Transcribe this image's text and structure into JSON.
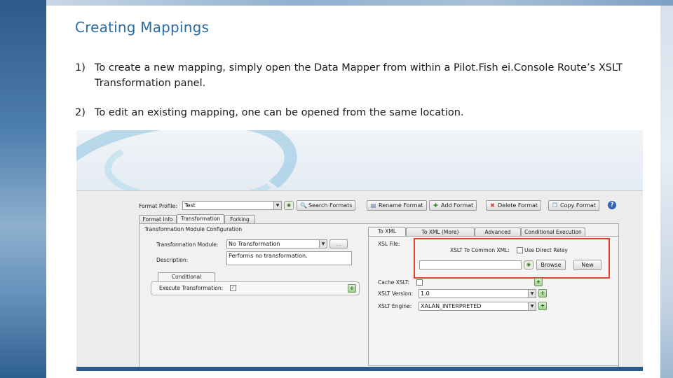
{
  "slide": {
    "title": "Creating Mappings",
    "steps": [
      {
        "num": "1)",
        "line1": "To create a new mapping, simply open the Data Mapper from within a Pilot.Fish ei.Console Route’s XSLT",
        "line2": "Transformation panel."
      },
      {
        "num": "2)",
        "line1": "To edit an existing mapping, one can be opened from the same location."
      }
    ]
  },
  "app": {
    "format_profile_label": "Format Profile:",
    "format_profile_value": "Test",
    "toolbar": {
      "search": "Search Formats",
      "rename": "Rename Format",
      "add": "Add Format",
      "delete": "Delete Format",
      "copy": "Copy Format",
      "help": "?"
    },
    "tabs_top": [
      "Format Info",
      "Transformation",
      "Forking"
    ],
    "module_config_title": "Transformation Module Configuration",
    "module_label": "Transformation Module:",
    "module_value": "No Transformation",
    "module_more": "...",
    "description_label": "Description:",
    "description_value": "Performs no transformation.",
    "cond_exec_tab": "Conditional Execution",
    "execute_label": "Execute Transformation:",
    "tabs_right": [
      "To XML",
      "To XML (More)",
      "Advanced",
      "Conditional Execution"
    ],
    "xsl_file_label": "XSL File:",
    "xslt_common_label": "XSLT To Common XML:",
    "direct_relay_label": "Use Direct Relay",
    "browse": "Browse",
    "new": "New",
    "cache_label": "Cache XSLT:",
    "version_label": "XSLT Version:",
    "version_value": "1.0",
    "engine_label": "XSLT Engine:",
    "engine_value": "XALAN_INTERPRETED",
    "colors": {
      "title": "#2a6aa0",
      "highlight": "#e0452c"
    }
  }
}
